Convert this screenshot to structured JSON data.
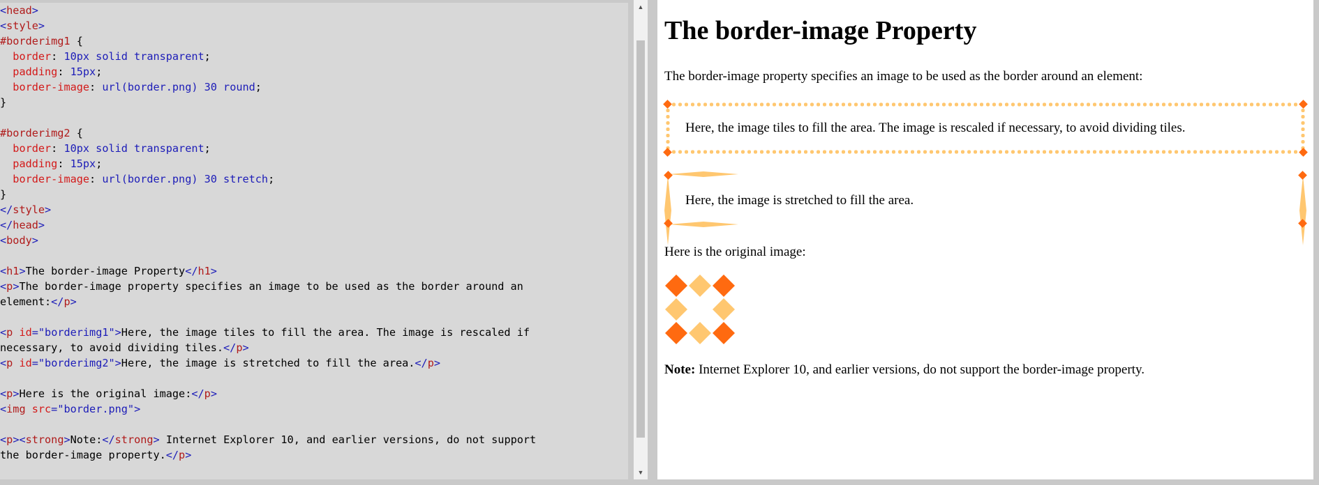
{
  "editor": {
    "lines": [
      [
        {
          "c": "tg",
          "t": "<"
        },
        {
          "c": "tn",
          "t": "head"
        },
        {
          "c": "tg",
          "t": ">"
        }
      ],
      [
        {
          "c": "tg",
          "t": "<"
        },
        {
          "c": "tn",
          "t": "style"
        },
        {
          "c": "tg",
          "t": ">"
        }
      ],
      [
        {
          "c": "sl",
          "t": "#borderimg1"
        },
        {
          "c": "tx",
          "t": " {"
        }
      ],
      [
        {
          "c": "tx",
          "t": "  "
        },
        {
          "c": "pr",
          "t": "border"
        },
        {
          "c": "tx",
          "t": ": "
        },
        {
          "c": "vl",
          "t": "10px solid transparent"
        },
        {
          "c": "tx",
          "t": ";"
        }
      ],
      [
        {
          "c": "tx",
          "t": "  "
        },
        {
          "c": "pr",
          "t": "padding"
        },
        {
          "c": "tx",
          "t": ": "
        },
        {
          "c": "vl",
          "t": "15px"
        },
        {
          "c": "tx",
          "t": ";"
        }
      ],
      [
        {
          "c": "tx",
          "t": "  "
        },
        {
          "c": "pr",
          "t": "border-image"
        },
        {
          "c": "tx",
          "t": ": "
        },
        {
          "c": "vl",
          "t": "url(border.png) 30 round"
        },
        {
          "c": "tx",
          "t": ";"
        }
      ],
      [
        {
          "c": "tx",
          "t": "}"
        }
      ],
      [
        {
          "c": "tx",
          "t": ""
        }
      ],
      [
        {
          "c": "sl",
          "t": "#borderimg2"
        },
        {
          "c": "tx",
          "t": " {"
        }
      ],
      [
        {
          "c": "tx",
          "t": "  "
        },
        {
          "c": "pr",
          "t": "border"
        },
        {
          "c": "tx",
          "t": ": "
        },
        {
          "c": "vl",
          "t": "10px solid transparent"
        },
        {
          "c": "tx",
          "t": ";"
        }
      ],
      [
        {
          "c": "tx",
          "t": "  "
        },
        {
          "c": "pr",
          "t": "padding"
        },
        {
          "c": "tx",
          "t": ": "
        },
        {
          "c": "vl",
          "t": "15px"
        },
        {
          "c": "tx",
          "t": ";"
        }
      ],
      [
        {
          "c": "tx",
          "t": "  "
        },
        {
          "c": "pr",
          "t": "border-image"
        },
        {
          "c": "tx",
          "t": ": "
        },
        {
          "c": "vl",
          "t": "url(border.png) 30 stretch"
        },
        {
          "c": "tx",
          "t": ";"
        }
      ],
      [
        {
          "c": "tx",
          "t": "}"
        }
      ],
      [
        {
          "c": "tg",
          "t": "</"
        },
        {
          "c": "tn",
          "t": "style"
        },
        {
          "c": "tg",
          "t": ">"
        }
      ],
      [
        {
          "c": "tg",
          "t": "</"
        },
        {
          "c": "tn",
          "t": "head"
        },
        {
          "c": "tg",
          "t": ">"
        }
      ],
      [
        {
          "c": "tg",
          "t": "<"
        },
        {
          "c": "tn",
          "t": "body"
        },
        {
          "c": "tg",
          "t": ">"
        }
      ],
      [
        {
          "c": "tx",
          "t": ""
        }
      ],
      [
        {
          "c": "tg",
          "t": "<"
        },
        {
          "c": "tn",
          "t": "h1"
        },
        {
          "c": "tg",
          "t": ">"
        },
        {
          "c": "tx",
          "t": "The border-image Property"
        },
        {
          "c": "tg",
          "t": "</"
        },
        {
          "c": "tn",
          "t": "h1"
        },
        {
          "c": "tg",
          "t": ">"
        }
      ],
      [
        {
          "c": "tg",
          "t": "<"
        },
        {
          "c": "tn",
          "t": "p"
        },
        {
          "c": "tg",
          "t": ">"
        },
        {
          "c": "tx",
          "t": "The border-image property specifies an image to be used as the border around an"
        }
      ],
      [
        {
          "c": "tx",
          "t": "element:"
        },
        {
          "c": "tg",
          "t": "</"
        },
        {
          "c": "tn",
          "t": "p"
        },
        {
          "c": "tg",
          "t": ">"
        }
      ],
      [
        {
          "c": "tx",
          "t": ""
        }
      ],
      [
        {
          "c": "tg",
          "t": "<"
        },
        {
          "c": "tn",
          "t": "p "
        },
        {
          "c": "at",
          "t": "id"
        },
        {
          "c": "tg",
          "t": "="
        },
        {
          "c": "av",
          "t": "\"borderimg1\""
        },
        {
          "c": "tg",
          "t": ">"
        },
        {
          "c": "tx",
          "t": "Here, the image tiles to fill the area. The image is rescaled if"
        }
      ],
      [
        {
          "c": "tx",
          "t": "necessary, to avoid dividing tiles."
        },
        {
          "c": "tg",
          "t": "</"
        },
        {
          "c": "tn",
          "t": "p"
        },
        {
          "c": "tg",
          "t": ">"
        }
      ],
      [
        {
          "c": "tg",
          "t": "<"
        },
        {
          "c": "tn",
          "t": "p "
        },
        {
          "c": "at",
          "t": "id"
        },
        {
          "c": "tg",
          "t": "="
        },
        {
          "c": "av",
          "t": "\"borderimg2\""
        },
        {
          "c": "tg",
          "t": ">"
        },
        {
          "c": "tx",
          "t": "Here, the image is stretched to fill the area."
        },
        {
          "c": "tg",
          "t": "</"
        },
        {
          "c": "tn",
          "t": "p"
        },
        {
          "c": "tg",
          "t": ">"
        }
      ],
      [
        {
          "c": "tx",
          "t": ""
        }
      ],
      [
        {
          "c": "tg",
          "t": "<"
        },
        {
          "c": "tn",
          "t": "p"
        },
        {
          "c": "tg",
          "t": ">"
        },
        {
          "c": "tx",
          "t": "Here is the original image:"
        },
        {
          "c": "tg",
          "t": "</"
        },
        {
          "c": "tn",
          "t": "p"
        },
        {
          "c": "tg",
          "t": ">"
        }
      ],
      [
        {
          "c": "tg",
          "t": "<"
        },
        {
          "c": "tn",
          "t": "img "
        },
        {
          "c": "at",
          "t": "src"
        },
        {
          "c": "tg",
          "t": "="
        },
        {
          "c": "av",
          "t": "\"border.png\""
        },
        {
          "c": "tg",
          "t": ">"
        }
      ],
      [
        {
          "c": "tx",
          "t": ""
        }
      ],
      [
        {
          "c": "tg",
          "t": "<"
        },
        {
          "c": "tn",
          "t": "p"
        },
        {
          "c": "tg",
          "t": "><"
        },
        {
          "c": "tn",
          "t": "strong"
        },
        {
          "c": "tg",
          "t": ">"
        },
        {
          "c": "tx",
          "t": "Note:"
        },
        {
          "c": "tg",
          "t": "</"
        },
        {
          "c": "tn",
          "t": "strong"
        },
        {
          "c": "tg",
          "t": ">"
        },
        {
          "c": "tx",
          "t": " Internet Explorer 10, and earlier versions, do not support"
        }
      ],
      [
        {
          "c": "tx",
          "t": "the border-image property."
        },
        {
          "c": "tg",
          "t": "</"
        },
        {
          "c": "tn",
          "t": "p"
        },
        {
          "c": "tg",
          "t": ">"
        }
      ]
    ]
  },
  "result": {
    "title": "The border-image Property",
    "intro": "The border-image property specifies an image to be used as the border around an element:",
    "borderimg1_text": "Here, the image tiles to fill the area. The image is rescaled if necessary, to avoid dividing tiles.",
    "borderimg2_text": "Here, the image is stretched to fill the area.",
    "original_label": "Here is the original image:",
    "note_strong": "Note:",
    "note_text": " Internet Explorer 10, and earlier versions, do not support the border-image property."
  },
  "colors": {
    "border_light": "#ffc770",
    "border_dark": "#ff6a10",
    "editor_bg": "#d8d8d8"
  }
}
